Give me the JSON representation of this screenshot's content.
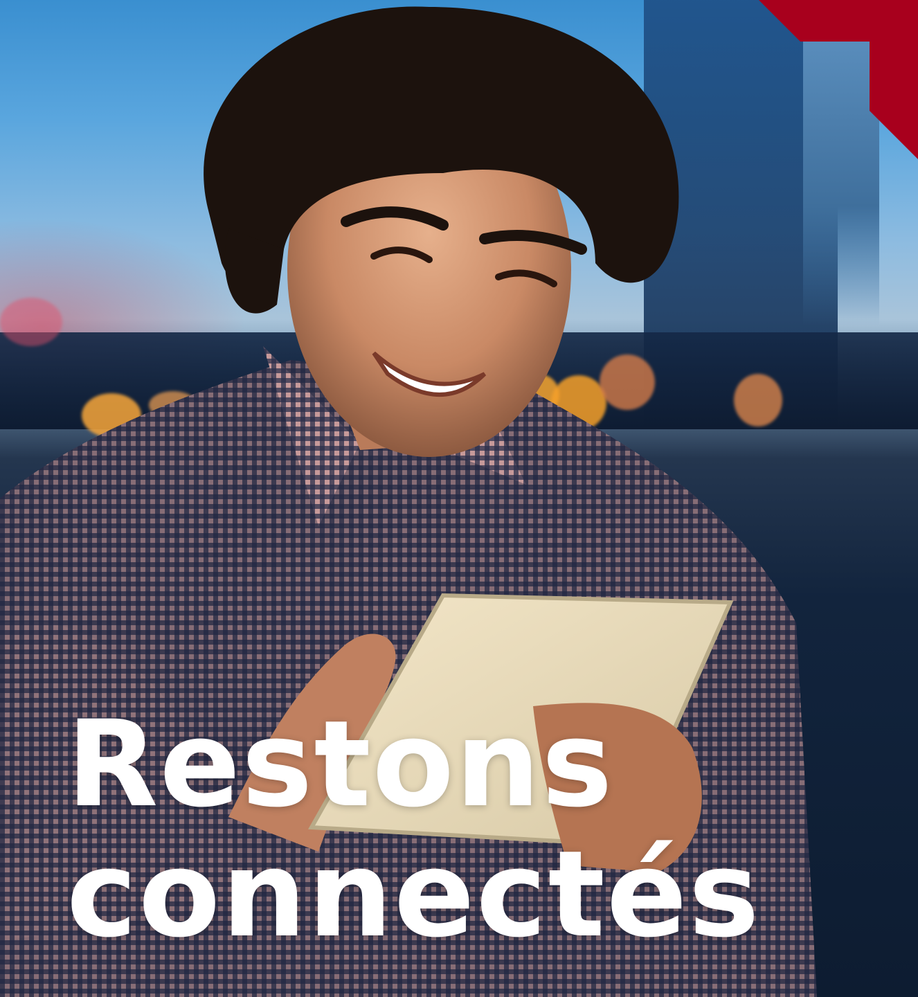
{
  "headline": {
    "line1": "Restons",
    "line2": "connectés"
  },
  "colors": {
    "accent": "#a8001d",
    "text": "#ffffff",
    "night_sky": "#12243d"
  },
  "icons": {
    "corner": "corner-chevron-icon"
  }
}
